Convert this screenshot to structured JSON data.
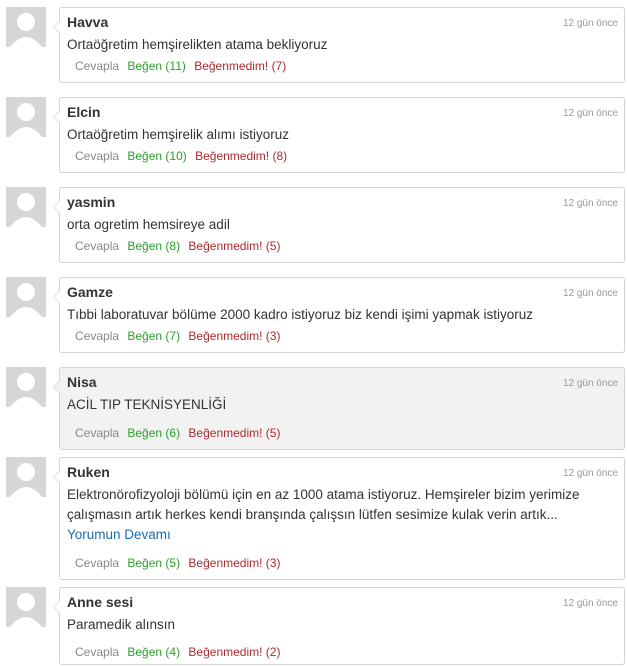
{
  "comments": [
    {
      "author": "Havva",
      "time": "12 gün önce",
      "text": "Ortaöğretim hemşirelikten atama bekliyoruz",
      "more": "",
      "reply": "Cevapla",
      "like": "Beğen (11)",
      "dislike": "Beğenmedim! (7)"
    },
    {
      "author": "Elcin",
      "time": "12 gün önce",
      "text": "Ortaöğretim hemşirelik alımı istiyoruz",
      "more": "",
      "reply": "Cevapla",
      "like": "Beğen (10)",
      "dislike": "Beğenmedim! (8)"
    },
    {
      "author": "yasmin",
      "time": "12 gün önce",
      "text": "orta ogretim hemsireye adil",
      "more": "",
      "reply": "Cevapla",
      "like": "Beğen (8)",
      "dislike": "Beğenmedim! (5)"
    },
    {
      "author": "Gamze",
      "time": "12 gün önce",
      "text": "Tıbbi laboratuvar bölüme 2000 kadro istiyoruz biz kendi işimi yapmak istiyoruz",
      "more": "",
      "reply": "Cevapla",
      "like": "Beğen (7)",
      "dislike": "Beğenmedim! (3)"
    },
    {
      "author": "Nisa",
      "time": "12 gün önce",
      "text": "ACİL TIP TEKNİSYENLİĞİ",
      "more": "",
      "reply": "Cevapla",
      "like": "Beğen (6)",
      "dislike": "Beğenmedim! (5)"
    },
    {
      "author": "Ruken",
      "time": "12 gün önce",
      "text": "Elektronörofizyoloji bölümü için en az 1000 atama istiyoruz. Hemşireler bizim yerimize çalışmasın artık herkes kendi branşında çalışsın lütfen sesimize kulak verin artık... ",
      "more": "Yorumun Devamı",
      "reply": "Cevapla",
      "like": "Beğen (5)",
      "dislike": "Beğenmedim! (3)"
    },
    {
      "author": "Anne sesi",
      "time": "12 gün önce",
      "text": "Paramedik alınsın",
      "more": "",
      "reply": "Cevapla",
      "like": "Beğen (4)",
      "dislike": "Beğenmedim! (2)"
    }
  ]
}
